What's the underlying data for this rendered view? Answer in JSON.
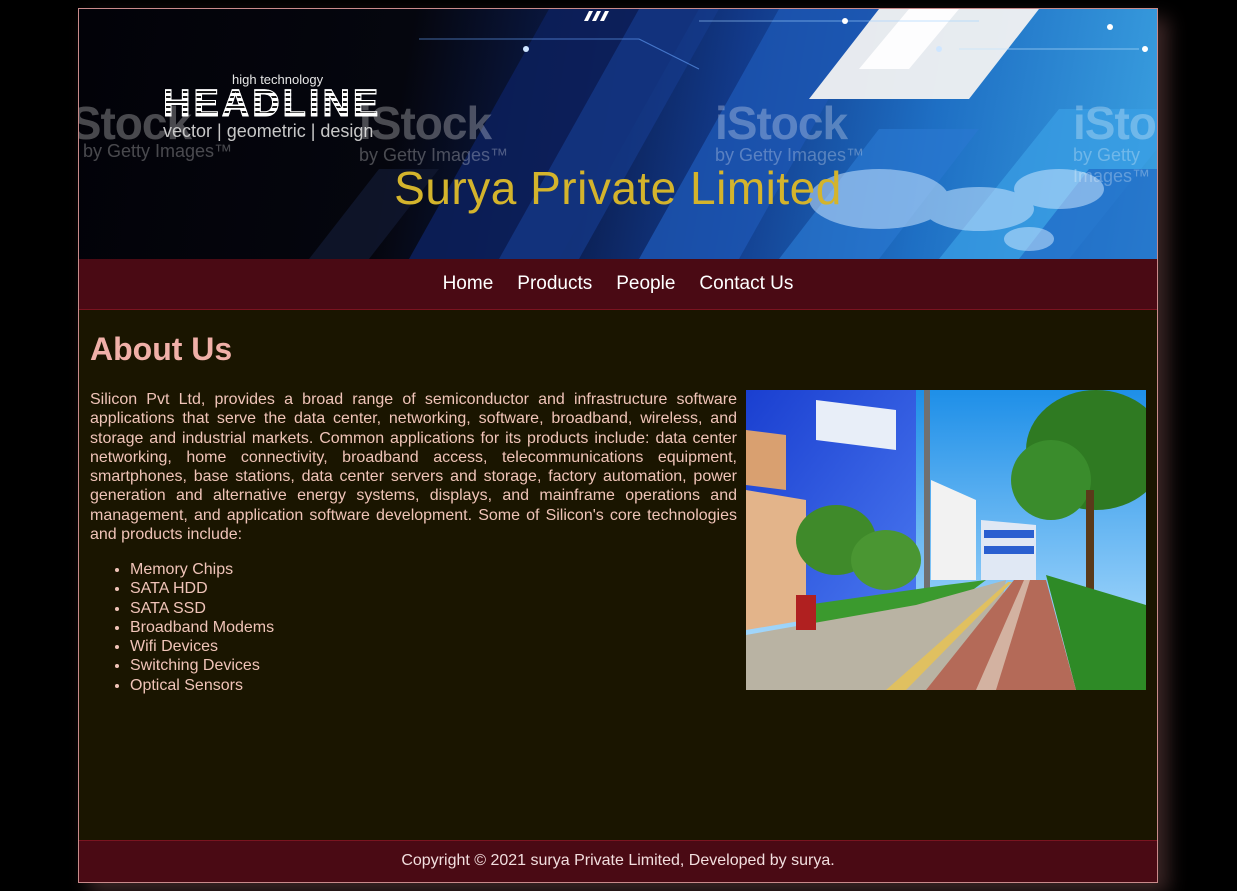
{
  "banner": {
    "company_name": "Surya Private Limited",
    "kicker": "high technology",
    "headline": "HEADLINE",
    "subline": "vector | geometric | design",
    "watermarks": [
      {
        "main": "iStock",
        "sub": "by Getty Images™"
      },
      {
        "main": "iStock",
        "sub": "by Getty Images™"
      },
      {
        "main": "iStock",
        "sub": "by Getty Images™"
      },
      {
        "main": "iStock",
        "sub": "by Getty Images™"
      }
    ]
  },
  "nav": {
    "items": [
      "Home",
      "Products",
      "People",
      "Contact Us"
    ]
  },
  "about": {
    "title": "About Us",
    "paragraph": "Silicon Pvt Ltd, provides a broad range of semiconductor and infrastructure software applications that serve the data center, networking, software, broadband, wireless, and storage and industrial markets. Common applications for its products include: data center networking, home connectivity, broadband access, telecommunications equipment, smartphones, base stations, data center servers and storage, factory automation, power generation and alternative energy systems, displays, and mainframe operations and management, and application software development. Some of Silicon's core technologies and products include:",
    "products": [
      "Memory Chips",
      "SATA HDD",
      "SATA SSD",
      "Broadband Modems",
      "Wifi Devices",
      "Switching Devices",
      "Optical Sensors"
    ]
  },
  "footer": {
    "text": "Copyright © 2021 surya Private Limited, Developed by surya."
  },
  "colors": {
    "page_bg": "#000000",
    "content_bg": "#1a1500",
    "bar_bg": "#4a0a14",
    "title_gold": "#d4b42c",
    "heading_pink": "#f0b0a8",
    "body_text": "#f0c4b8"
  }
}
